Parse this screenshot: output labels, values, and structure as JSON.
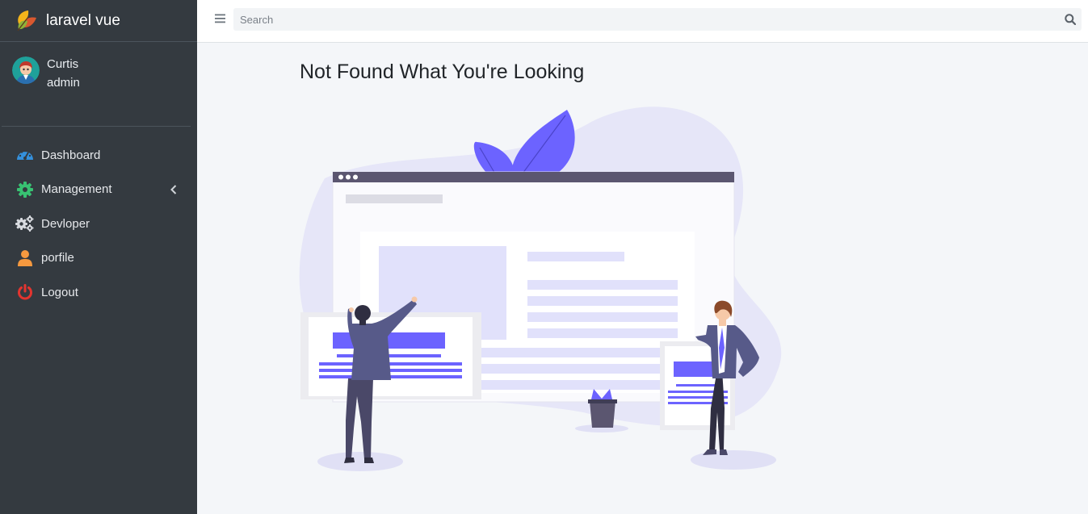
{
  "brand": {
    "name": "laravel vue"
  },
  "user": {
    "name": "Curtis",
    "role": "admin"
  },
  "nav": {
    "items": [
      {
        "label": "Dashboard",
        "icon": "tachometer-icon",
        "color": "#3490dc"
      },
      {
        "label": "Management",
        "icon": "cog-icon",
        "color": "#38c172"
      },
      {
        "label": "Devloper",
        "icon": "cogs-icon",
        "color": "#d8dbe0"
      },
      {
        "label": "porfile",
        "icon": "user-icon",
        "color": "#f6993f"
      },
      {
        "label": "Logout",
        "icon": "power-off-icon",
        "color": "#e3342f"
      }
    ]
  },
  "search": {
    "placeholder": "Search",
    "value": ""
  },
  "content": {
    "title": "Not Found What You're Looking"
  },
  "colors": {
    "sidebar": "#343a40",
    "accent": "#6c63ff",
    "background": "#f4f6f9"
  }
}
